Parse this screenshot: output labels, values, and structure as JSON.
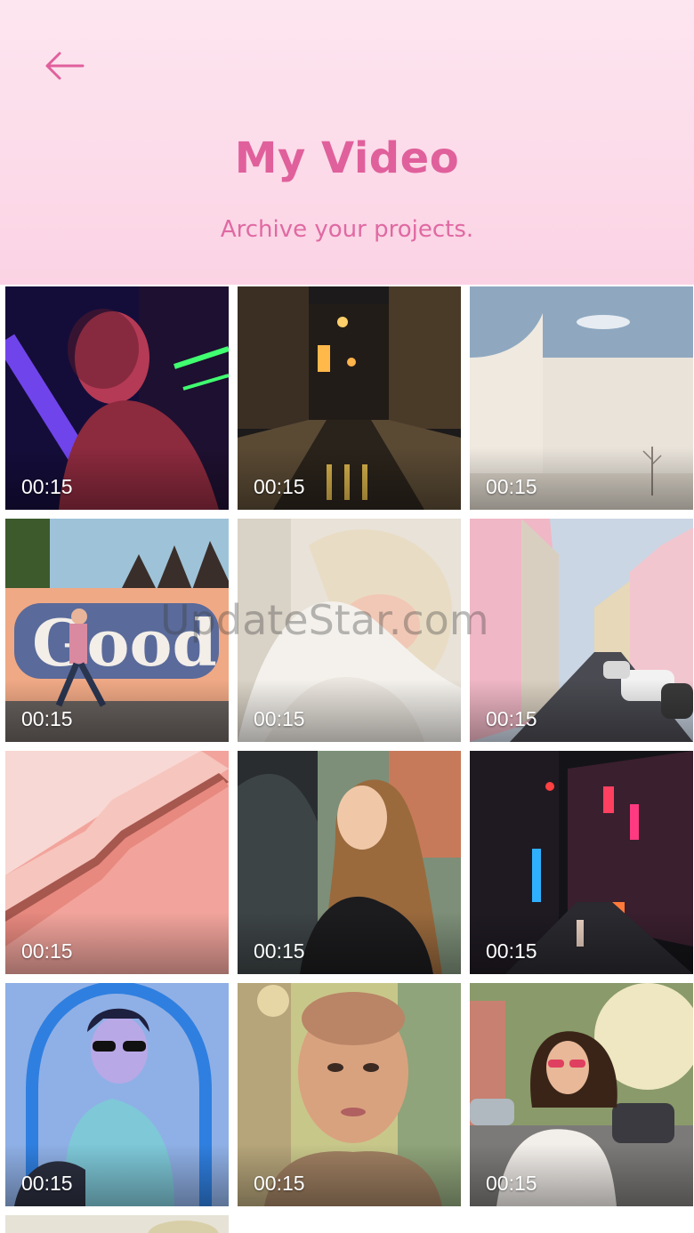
{
  "header": {
    "back_icon": "arrow-left-icon",
    "title": "My Video",
    "subtitle": "Archive your projects."
  },
  "colors": {
    "accent": "#e0609c",
    "header_top": "#fde6f0",
    "header_bottom": "#fbd3e4"
  },
  "videos": [
    {
      "duration": "00:15",
      "scene": "portrait-neon"
    },
    {
      "duration": "00:15",
      "scene": "night-street"
    },
    {
      "duration": "00:15",
      "scene": "white-building"
    },
    {
      "duration": "00:15",
      "scene": "graffiti-wall"
    },
    {
      "duration": "00:15",
      "scene": "blonde-portrait"
    },
    {
      "duration": "00:15",
      "scene": "pink-street"
    },
    {
      "duration": "00:15",
      "scene": "pink-staircase"
    },
    {
      "duration": "00:15",
      "scene": "woman-market"
    },
    {
      "duration": "00:15",
      "scene": "neon-alley"
    },
    {
      "duration": "00:15",
      "scene": "blue-arch-portrait"
    },
    {
      "duration": "00:15",
      "scene": "shaved-head-portrait"
    },
    {
      "duration": "00:15",
      "scene": "sunny-street-portrait"
    },
    {
      "duration": "",
      "scene": "partial-next-row"
    }
  ],
  "watermark": "UpdateStar.com"
}
